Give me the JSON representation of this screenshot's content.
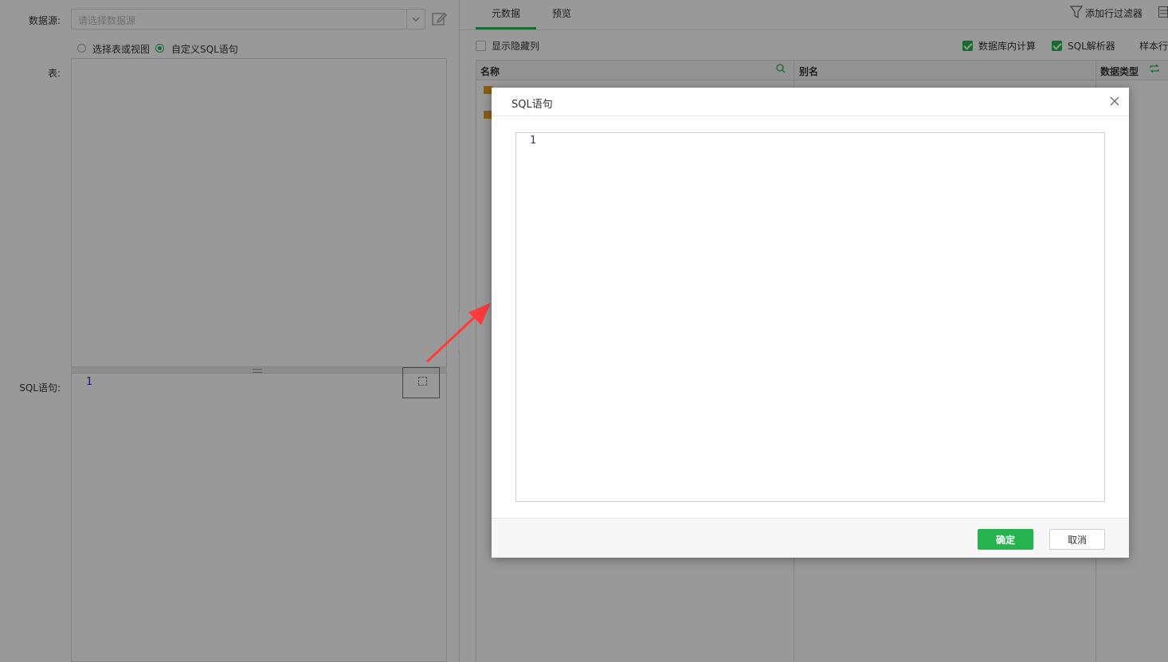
{
  "left": {
    "datasource_label": "数据源:",
    "datasource_placeholder": "请选择数据源",
    "radio_table_label": "选择表或视图",
    "radio_sql_label": "自定义SQL语句",
    "table_label": "表:",
    "sql_label": "SQL语句:",
    "sql_line_number": "1"
  },
  "right": {
    "tabs": [
      {
        "label": "元数据",
        "active": true
      },
      {
        "label": "预览",
        "active": false
      }
    ],
    "add_filter_label": "添加行过滤器",
    "show_hidden_label": "显示隐藏列",
    "db_compute_label": "数据库内计算",
    "sql_parser_label": "SQL解析器",
    "sample_label": "样本行",
    "columns": {
      "name": "名称",
      "alias": "别名",
      "type": "数据类型"
    }
  },
  "dialog": {
    "title": "SQL语句",
    "line_number": "1",
    "ok_label": "确定",
    "cancel_label": "取消"
  },
  "colors": {
    "accent": "#27b350",
    "highlight": "#ff3b3b",
    "folder": "#e49b24"
  }
}
